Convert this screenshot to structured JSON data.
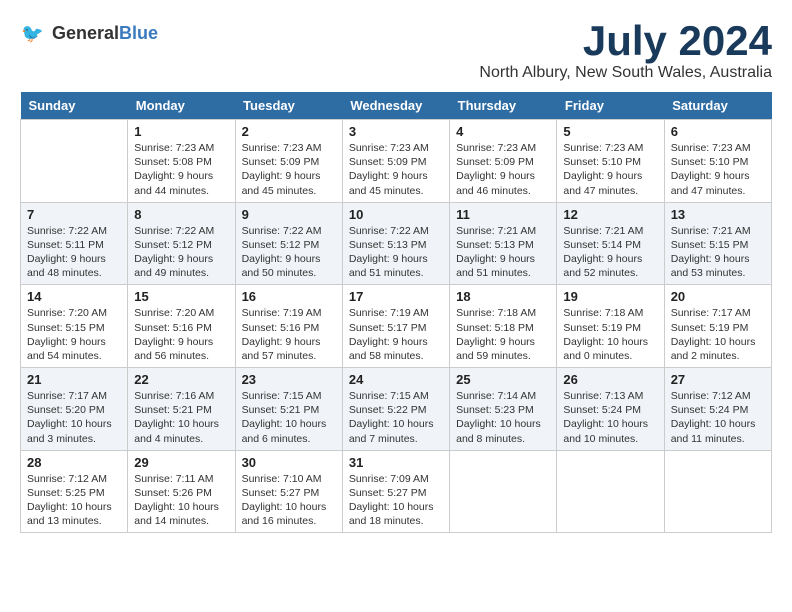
{
  "header": {
    "logo_line1": "General",
    "logo_line2": "Blue",
    "month_title": "July 2024",
    "location": "North Albury, New South Wales, Australia"
  },
  "calendar": {
    "headers": [
      "Sunday",
      "Monday",
      "Tuesday",
      "Wednesday",
      "Thursday",
      "Friday",
      "Saturday"
    ],
    "weeks": [
      [
        {
          "day": "",
          "info": ""
        },
        {
          "day": "1",
          "info": "Sunrise: 7:23 AM\nSunset: 5:08 PM\nDaylight: 9 hours\nand 44 minutes."
        },
        {
          "day": "2",
          "info": "Sunrise: 7:23 AM\nSunset: 5:09 PM\nDaylight: 9 hours\nand 45 minutes."
        },
        {
          "day": "3",
          "info": "Sunrise: 7:23 AM\nSunset: 5:09 PM\nDaylight: 9 hours\nand 45 minutes."
        },
        {
          "day": "4",
          "info": "Sunrise: 7:23 AM\nSunset: 5:09 PM\nDaylight: 9 hours\nand 46 minutes."
        },
        {
          "day": "5",
          "info": "Sunrise: 7:23 AM\nSunset: 5:10 PM\nDaylight: 9 hours\nand 47 minutes."
        },
        {
          "day": "6",
          "info": "Sunrise: 7:23 AM\nSunset: 5:10 PM\nDaylight: 9 hours\nand 47 minutes."
        }
      ],
      [
        {
          "day": "7",
          "info": "Sunrise: 7:22 AM\nSunset: 5:11 PM\nDaylight: 9 hours\nand 48 minutes."
        },
        {
          "day": "8",
          "info": "Sunrise: 7:22 AM\nSunset: 5:12 PM\nDaylight: 9 hours\nand 49 minutes."
        },
        {
          "day": "9",
          "info": "Sunrise: 7:22 AM\nSunset: 5:12 PM\nDaylight: 9 hours\nand 50 minutes."
        },
        {
          "day": "10",
          "info": "Sunrise: 7:22 AM\nSunset: 5:13 PM\nDaylight: 9 hours\nand 51 minutes."
        },
        {
          "day": "11",
          "info": "Sunrise: 7:21 AM\nSunset: 5:13 PM\nDaylight: 9 hours\nand 51 minutes."
        },
        {
          "day": "12",
          "info": "Sunrise: 7:21 AM\nSunset: 5:14 PM\nDaylight: 9 hours\nand 52 minutes."
        },
        {
          "day": "13",
          "info": "Sunrise: 7:21 AM\nSunset: 5:15 PM\nDaylight: 9 hours\nand 53 minutes."
        }
      ],
      [
        {
          "day": "14",
          "info": "Sunrise: 7:20 AM\nSunset: 5:15 PM\nDaylight: 9 hours\nand 54 minutes."
        },
        {
          "day": "15",
          "info": "Sunrise: 7:20 AM\nSunset: 5:16 PM\nDaylight: 9 hours\nand 56 minutes."
        },
        {
          "day": "16",
          "info": "Sunrise: 7:19 AM\nSunset: 5:16 PM\nDaylight: 9 hours\nand 57 minutes."
        },
        {
          "day": "17",
          "info": "Sunrise: 7:19 AM\nSunset: 5:17 PM\nDaylight: 9 hours\nand 58 minutes."
        },
        {
          "day": "18",
          "info": "Sunrise: 7:18 AM\nSunset: 5:18 PM\nDaylight: 9 hours\nand 59 minutes."
        },
        {
          "day": "19",
          "info": "Sunrise: 7:18 AM\nSunset: 5:19 PM\nDaylight: 10 hours\nand 0 minutes."
        },
        {
          "day": "20",
          "info": "Sunrise: 7:17 AM\nSunset: 5:19 PM\nDaylight: 10 hours\nand 2 minutes."
        }
      ],
      [
        {
          "day": "21",
          "info": "Sunrise: 7:17 AM\nSunset: 5:20 PM\nDaylight: 10 hours\nand 3 minutes."
        },
        {
          "day": "22",
          "info": "Sunrise: 7:16 AM\nSunset: 5:21 PM\nDaylight: 10 hours\nand 4 minutes."
        },
        {
          "day": "23",
          "info": "Sunrise: 7:15 AM\nSunset: 5:21 PM\nDaylight: 10 hours\nand 6 minutes."
        },
        {
          "day": "24",
          "info": "Sunrise: 7:15 AM\nSunset: 5:22 PM\nDaylight: 10 hours\nand 7 minutes."
        },
        {
          "day": "25",
          "info": "Sunrise: 7:14 AM\nSunset: 5:23 PM\nDaylight: 10 hours\nand 8 minutes."
        },
        {
          "day": "26",
          "info": "Sunrise: 7:13 AM\nSunset: 5:24 PM\nDaylight: 10 hours\nand 10 minutes."
        },
        {
          "day": "27",
          "info": "Sunrise: 7:12 AM\nSunset: 5:24 PM\nDaylight: 10 hours\nand 11 minutes."
        }
      ],
      [
        {
          "day": "28",
          "info": "Sunrise: 7:12 AM\nSunset: 5:25 PM\nDaylight: 10 hours\nand 13 minutes."
        },
        {
          "day": "29",
          "info": "Sunrise: 7:11 AM\nSunset: 5:26 PM\nDaylight: 10 hours\nand 14 minutes."
        },
        {
          "day": "30",
          "info": "Sunrise: 7:10 AM\nSunset: 5:27 PM\nDaylight: 10 hours\nand 16 minutes."
        },
        {
          "day": "31",
          "info": "Sunrise: 7:09 AM\nSunset: 5:27 PM\nDaylight: 10 hours\nand 18 minutes."
        },
        {
          "day": "",
          "info": ""
        },
        {
          "day": "",
          "info": ""
        },
        {
          "day": "",
          "info": ""
        }
      ]
    ]
  }
}
